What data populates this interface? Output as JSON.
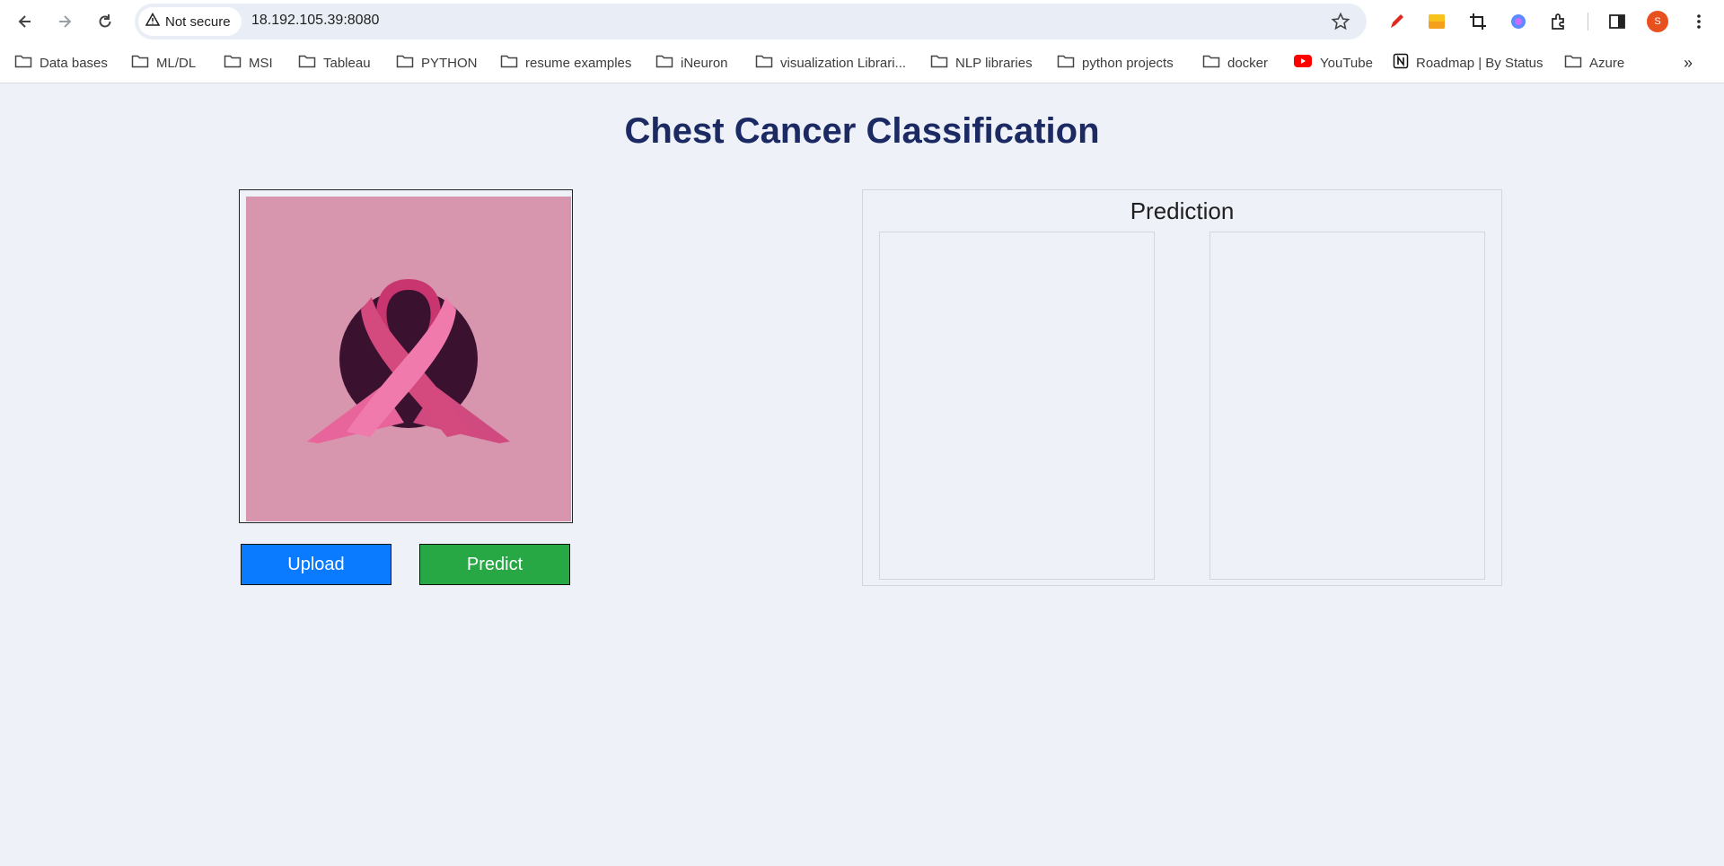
{
  "browser": {
    "security_label": "Not secure",
    "url": "18.192.105.39:8080",
    "profile_initial": "S",
    "icons": [
      "back-icon",
      "forward-icon",
      "reload-icon",
      "warning-icon",
      "star-icon",
      "pen-icon",
      "screenshot-icon",
      "crop-icon",
      "copilot-icon",
      "extensions-icon",
      "side-panel-icon",
      "menu-icon"
    ]
  },
  "bookmarks": [
    {
      "label": "Data bases",
      "icon": "folder-icon"
    },
    {
      "label": "ML/DL",
      "icon": "folder-icon"
    },
    {
      "label": "MSI",
      "icon": "folder-icon"
    },
    {
      "label": "Tableau",
      "icon": "folder-icon"
    },
    {
      "label": "PYTHON",
      "icon": "folder-icon"
    },
    {
      "label": "resume examples",
      "icon": "folder-icon"
    },
    {
      "label": "iNeuron",
      "icon": "folder-icon"
    },
    {
      "label": "visualization Librari...",
      "icon": "folder-icon"
    },
    {
      "label": "NLP libraries",
      "icon": "folder-icon"
    },
    {
      "label": "python projects",
      "icon": "folder-icon"
    },
    {
      "label": "docker",
      "icon": "folder-icon"
    },
    {
      "label": "YouTube",
      "icon": "youtube-icon"
    },
    {
      "label": "Roadmap | By Status",
      "icon": "notion-icon"
    },
    {
      "label": "Azure",
      "icon": "folder-icon"
    }
  ],
  "page": {
    "title": "Chest Cancer Classification",
    "upload_label": "Upload",
    "predict_label": "Predict",
    "prediction_title": "Prediction"
  },
  "colors": {
    "title": "#1b2a63",
    "upload": "#0a7bff",
    "predict": "#28a745",
    "image_bg": "#d895ae",
    "background": "#eef1f8"
  }
}
